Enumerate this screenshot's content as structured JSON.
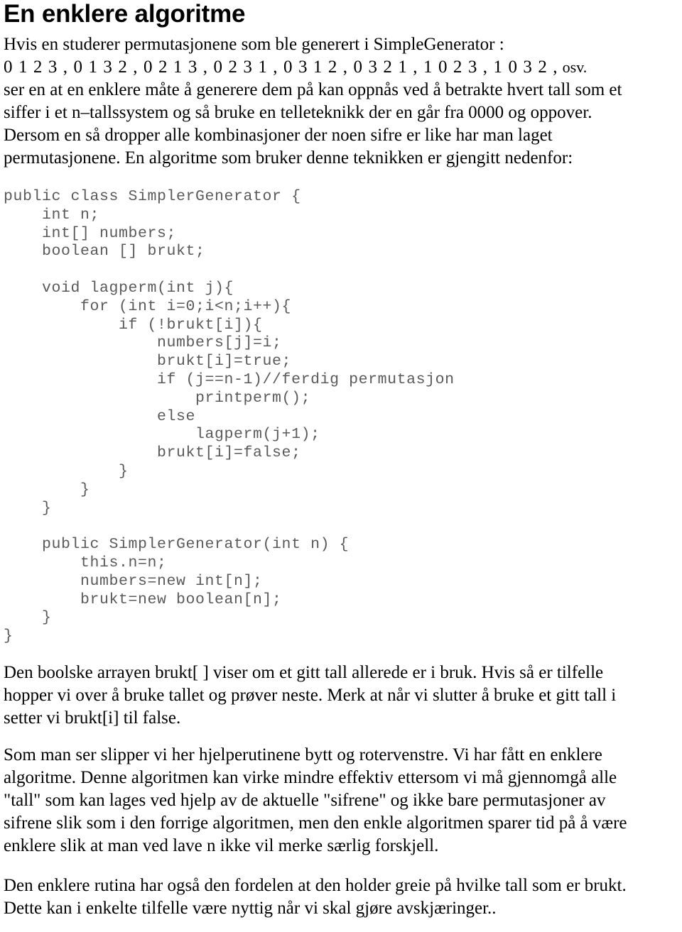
{
  "document": {
    "title": "En enklere algoritme",
    "intro": {
      "lines": [
        "Hvis en studerer permutasjonene som ble generert i SimpleGenerator :"
      ],
      "sequence": "0 1 2 3 , 0 1 3 2 , 0 2 1 3 , 0 2 3 1 , 0 3 1 2 , 0 3 2 1 , 1 0 2 3 , 1 0 3 2 ,",
      "sequence_tail": " osv."
    },
    "paragraph_2": {
      "lines": [
        "ser en at en enklere måte å generere dem på kan oppnås ved å betrakte hvert tall som et",
        "siffer i et n–tallssystem og så bruke en telleteknikk der en går fra 0000 og oppover.",
        "Dersom en så dropper alle kombinasjoner der noen sifre er like har man laget",
        "permutasjonene. En algoritme som bruker denne teknikken er gjengitt nedenfor:"
      ]
    },
    "code": {
      "language": "java",
      "lines": [
        "public class SimplerGenerator {",
        "    int n;",
        "    int[] numbers;",
        "    boolean [] brukt;",
        "",
        "    void lagperm(int j){",
        "        for (int i=0;i<n;i++){",
        "            if (!brukt[i]){",
        "                numbers[j]=i;",
        "                brukt[i]=true;",
        "                if (j==n-1)//ferdig permutasjon",
        "                    printperm();",
        "                else",
        "                    lagperm(j+1);",
        "                brukt[i]=false;",
        "            }",
        "        }",
        "    }",
        "",
        "    public SimplerGenerator(int n) {",
        "        this.n=n;",
        "        numbers=new int[n];",
        "        brukt=new boolean[n];",
        "    }",
        "}"
      ]
    },
    "paragraph_3": {
      "lines": [
        "Den boolske arrayen brukt[ ] viser om et gitt tall allerede er i bruk. Hvis så er tilfelle",
        "hopper vi over å bruke tallet og prøver neste. Merk at når vi slutter å bruke et gitt tall i",
        "setter vi brukt[i] til false."
      ]
    },
    "paragraph_4": {
      "lines": [
        "Som man ser slipper vi her hjelperutinene bytt og rotervenstre. Vi har fått en enklere",
        "algoritme. Denne algoritmen kan virke mindre effektiv ettersom vi må gjennomgå alle",
        "\"tall\" som kan lages ved hjelp av de aktuelle \"sifrene\" og ikke bare permutasjoner av",
        "sifrene slik som i den forrige algoritmen, men den enkle algoritmen sparer tid på å være",
        "enklere slik at man ved lave n ikke vil merke særlig forskjell."
      ]
    },
    "paragraph_5": {
      "lines": [
        "Den enklere rutina har også den fordelen at den holder greie på hvilke tall som er brukt.",
        "Dette kan i enkelte tilfelle være nyttig når vi skal gjøre avskjæringer.."
      ]
    },
    "colors": {
      "page_background": "#ffffff",
      "body_text": "#000000",
      "code_text": "#5a5a5a"
    }
  }
}
